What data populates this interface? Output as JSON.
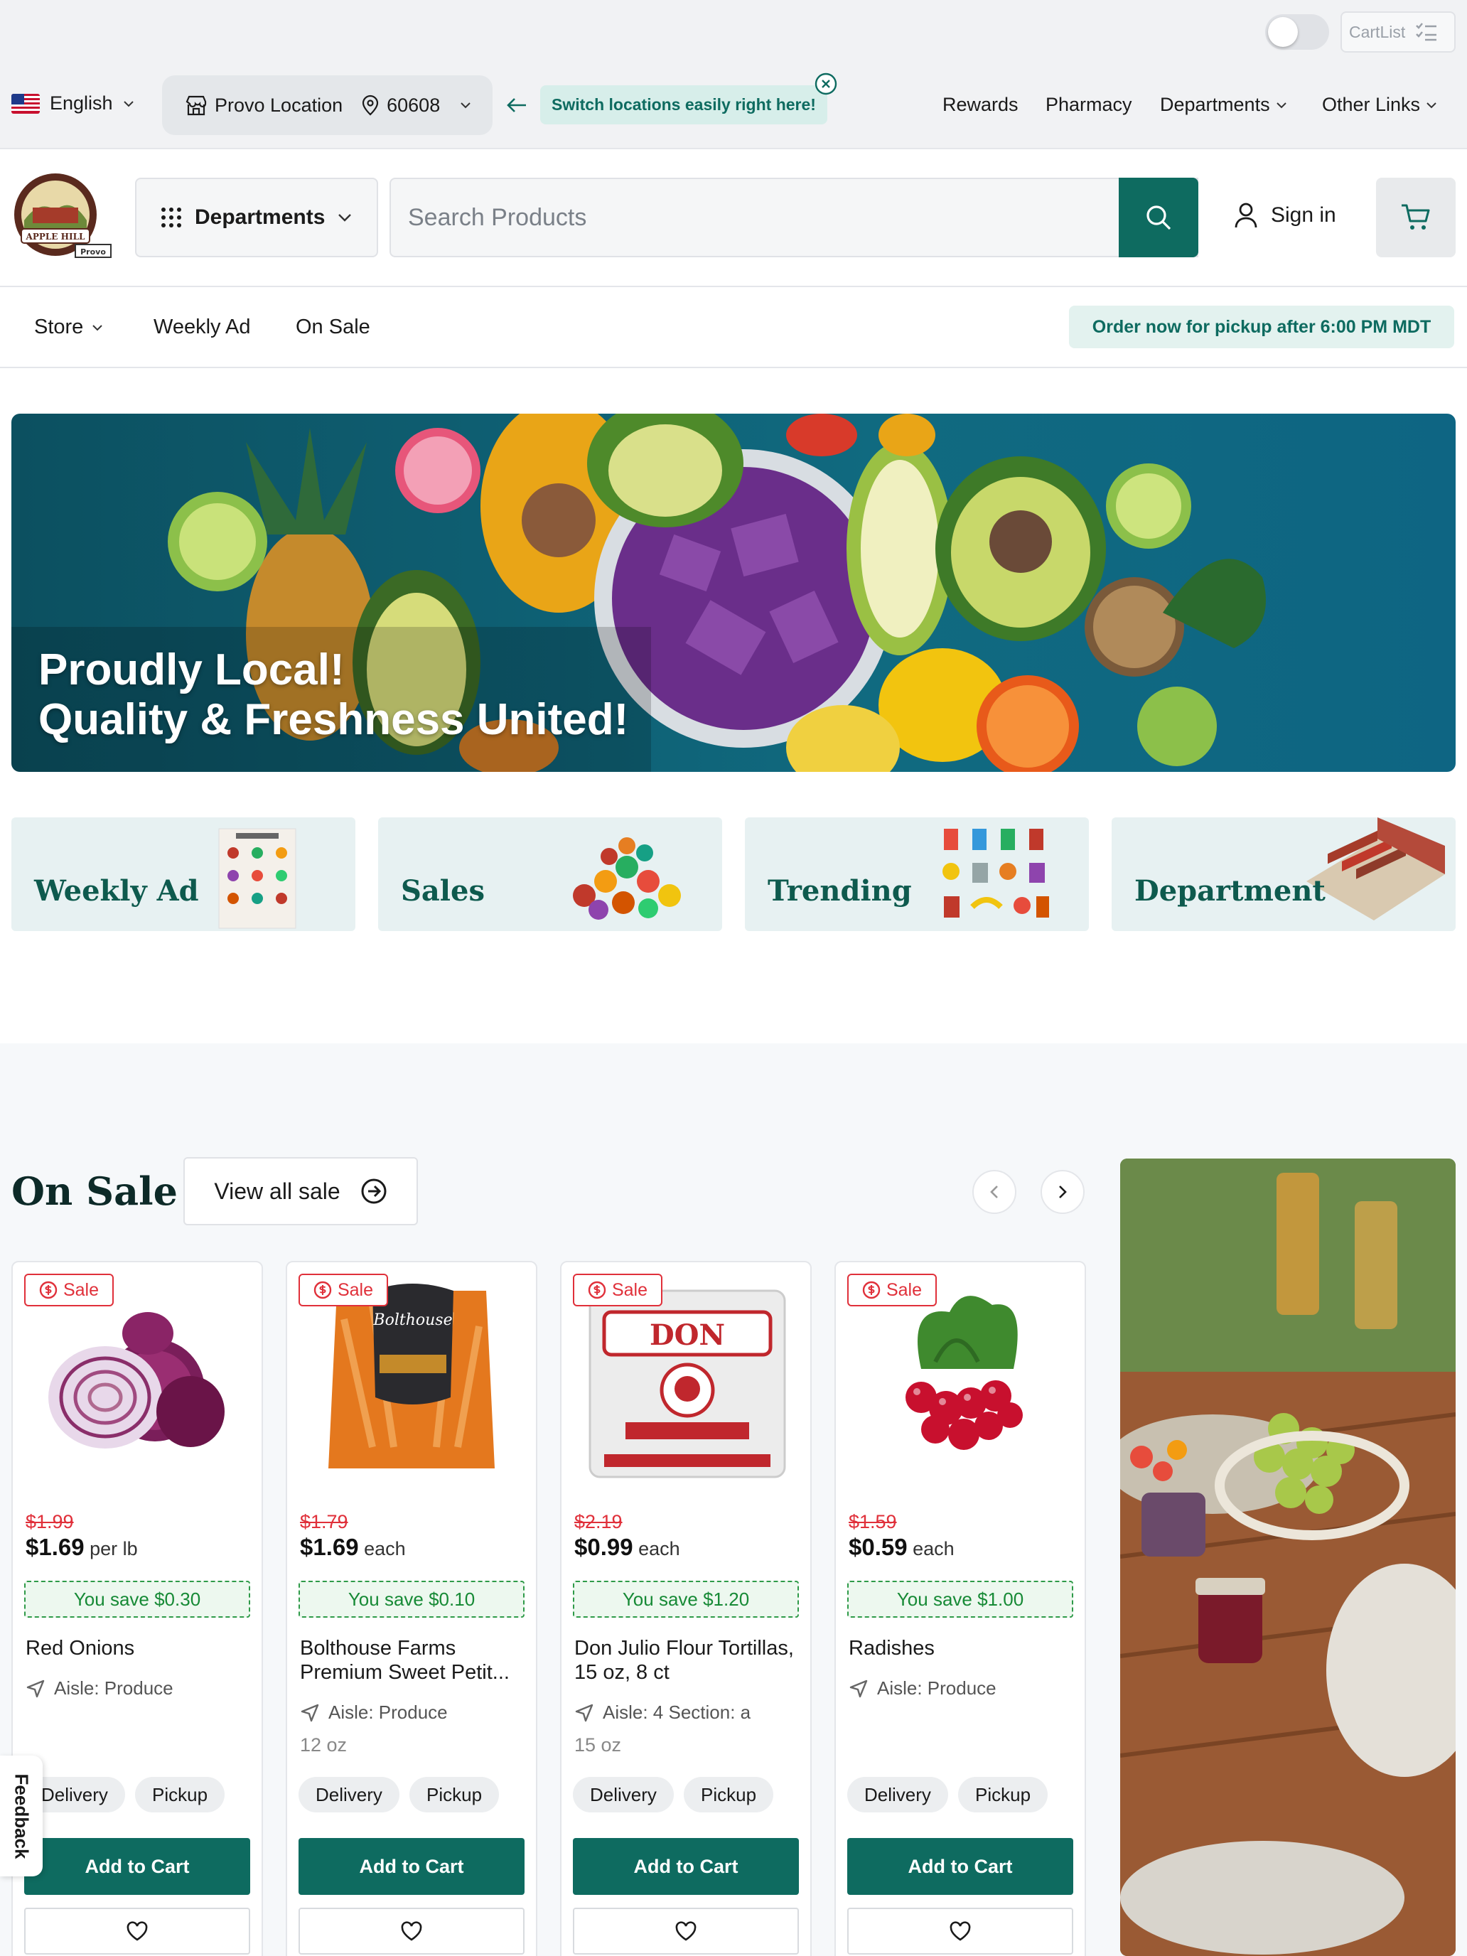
{
  "topbar": {
    "cartlist_label": "CartList",
    "language": "English",
    "location_name": "Provo Location",
    "zip": "60608",
    "switch_hint": "Switch locations easily right here!",
    "nav": [
      "Rewards",
      "Pharmacy",
      "Departments",
      "Other Links"
    ]
  },
  "header": {
    "logo_text": "APPLE HILL",
    "logo_subtext": "Provo",
    "departments_label": "Departments",
    "search_placeholder": "Search Products",
    "signin_label": "Sign in"
  },
  "subnav": {
    "store_label": "Store",
    "weekly_ad_label": "Weekly Ad",
    "on_sale_label": "On Sale",
    "pickup_note": "Order now for pickup after 6:00 PM MDT"
  },
  "hero": {
    "line1": "Proudly Local!",
    "line2": "Quality & Freshness United!"
  },
  "tiles": [
    "Weekly Ad",
    "Sales",
    "Trending",
    "Department"
  ],
  "sale": {
    "title": "On Sale",
    "view_all": "View all sale",
    "badge": "Sale",
    "products": [
      {
        "name": "Red Onions",
        "old_price": "$1.99",
        "price": "$1.69",
        "unit": "per lb",
        "save": "You save $0.30",
        "aisle": "Aisle: Produce",
        "size": ""
      },
      {
        "name": "Bolthouse Farms Premium Sweet Petit...",
        "old_price": "$1.79",
        "price": "$1.69",
        "unit": "each",
        "save": "You save $0.10",
        "aisle": "Aisle: Produce",
        "size": "12 oz"
      },
      {
        "name": "Don Julio Flour Tortillas, 15 oz, 8 ct",
        "old_price": "$2.19",
        "price": "$0.99",
        "unit": "each",
        "save": "You save $1.20",
        "aisle": "Aisle: 4 Section: a",
        "size": "15 oz"
      },
      {
        "name": "Radishes",
        "old_price": "$1.59",
        "price": "$0.59",
        "unit": "each",
        "save": "You save $1.00",
        "aisle": "Aisle: Produce",
        "size": ""
      }
    ],
    "delivery_label": "Delivery",
    "pickup_label": "Pickup",
    "add_to_cart": "Add to Cart"
  },
  "feedback_label": "Feedback",
  "colors": {
    "brand": "#0e6b60",
    "sale_red": "#e0303a",
    "save_green": "#178a36"
  }
}
